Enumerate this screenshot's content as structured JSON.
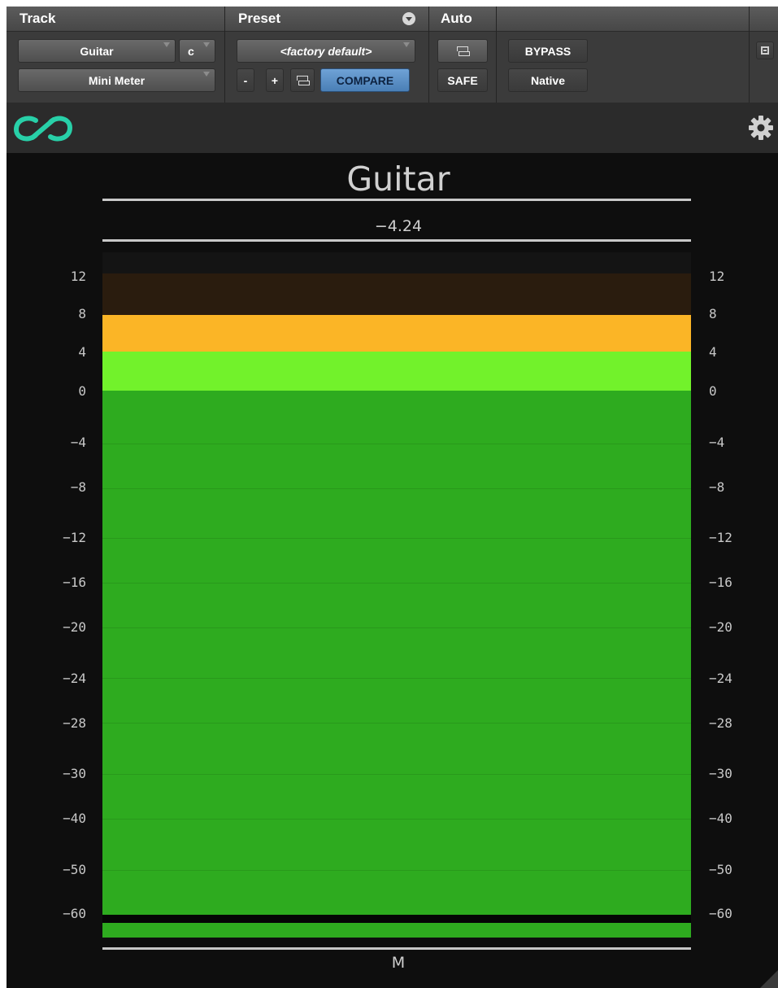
{
  "header": {
    "track_title": "Track",
    "preset_title": "Preset",
    "auto_title": "Auto",
    "track_name": "Guitar",
    "channel_letter": "c",
    "plugin_name": "Mini Meter",
    "preset_name": "<factory default>",
    "minus_label": "-",
    "plus_label": "+",
    "compare_label": "COMPARE",
    "safe_label": "SAFE",
    "bypass_label": "BYPASS",
    "native_label": "Native"
  },
  "meter": {
    "title": "Guitar",
    "peak_value": "−4.24",
    "channel_label": "M",
    "level_db": 0,
    "ticks": [
      "12",
      "8",
      "4",
      "0",
      "−4",
      "−8",
      "−12",
      "−16",
      "−20",
      "−24",
      "−28",
      "−30",
      "−40",
      "−50",
      "−60"
    ],
    "colors": {
      "zone_above_8": "#2a1c0e",
      "zone_4_to_8": "#fbb526",
      "zone_0_to_4": "#72f22b",
      "zone_below_0": "#2eab1f",
      "background": "#0e0e0e"
    }
  },
  "icons": {
    "logo": "infinity-link-logo-icon",
    "settings": "gear-icon",
    "link": "link-icon",
    "resize": "resize-corner-icon"
  }
}
